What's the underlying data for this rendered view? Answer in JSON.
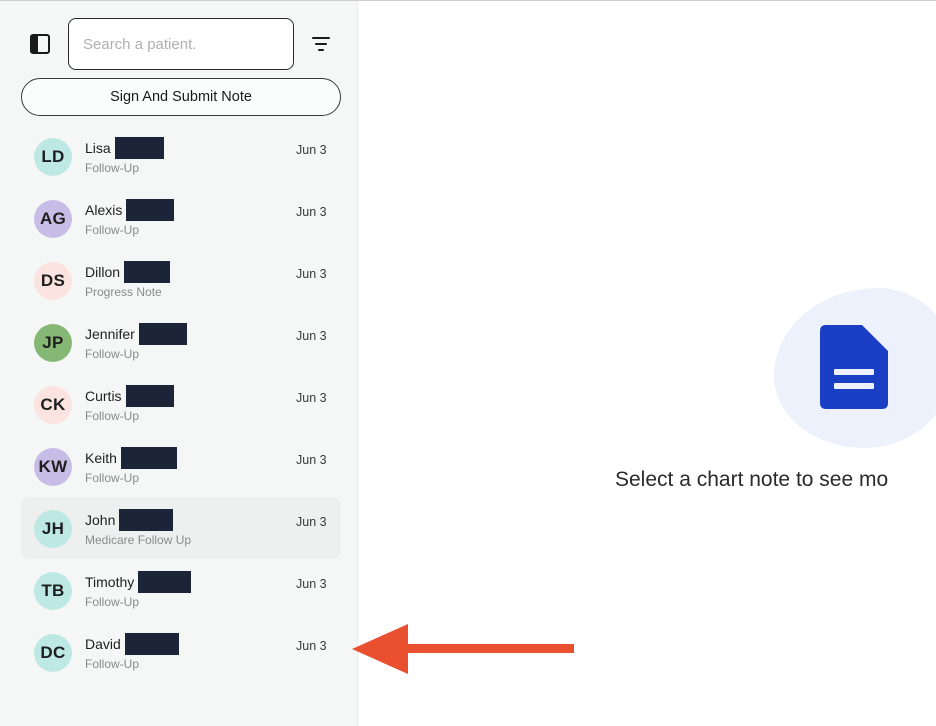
{
  "search": {
    "placeholder": "Search a patient."
  },
  "actions": {
    "sign_submit_label": "Sign And Submit Note"
  },
  "patients": [
    {
      "initials": "LD",
      "first_name": "Lisa",
      "note_type": "Follow-Up",
      "date": "Jun 3",
      "avatar_color": "#bde8e3"
    },
    {
      "initials": "AG",
      "first_name": "Alexis",
      "note_type": "Follow-Up",
      "date": "Jun 3",
      "avatar_color": "#c8bde6"
    },
    {
      "initials": "DS",
      "first_name": "Dillon",
      "note_type": "Progress Note",
      "date": "Jun 3",
      "avatar_color": "#fbe3e0"
    },
    {
      "initials": "JP",
      "first_name": "Jennifer",
      "note_type": "Follow-Up",
      "date": "Jun 3",
      "avatar_color": "#85b874"
    },
    {
      "initials": "CK",
      "first_name": "Curtis",
      "note_type": "Follow-Up",
      "date": "Jun 3",
      "avatar_color": "#fbe3e0"
    },
    {
      "initials": "KW",
      "first_name": "Keith",
      "note_type": "Follow-Up",
      "date": "Jun 3",
      "avatar_color": "#c8bde6"
    },
    {
      "initials": "JH",
      "first_name": "John",
      "note_type": "Medicare Follow Up",
      "date": "Jun 3",
      "avatar_color": "#bde8e3"
    },
    {
      "initials": "TB",
      "first_name": "Timothy",
      "note_type": "Follow-Up",
      "date": "Jun 3",
      "avatar_color": "#bde8e3"
    },
    {
      "initials": "DC",
      "first_name": "David",
      "note_type": "Follow-Up",
      "date": "Jun 3",
      "avatar_color": "#bde8e3"
    }
  ],
  "main": {
    "empty_message": "Select a chart note to see mo"
  },
  "colors": {
    "document_icon": "#1b3fc4",
    "annotation_arrow": "#e8502f",
    "redaction": "#1b2537"
  },
  "icons": {
    "sidebar_toggle": "sidebar-toggle-icon",
    "filter": "filter-icon",
    "document": "document-icon"
  }
}
